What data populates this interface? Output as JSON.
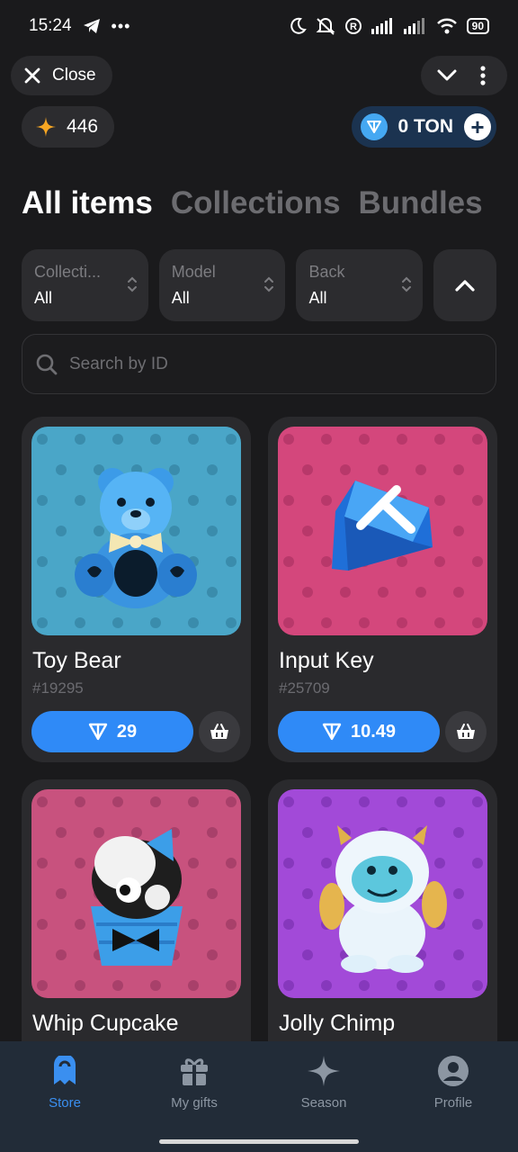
{
  "status_bar": {
    "time": "15:24",
    "battery": "90"
  },
  "topbar": {
    "close_label": "Close"
  },
  "balance": {
    "stars": "446",
    "ton": "0 TON"
  },
  "tabs": [
    {
      "label": "All items",
      "active": true
    },
    {
      "label": "Collections",
      "active": false
    },
    {
      "label": "Bundles",
      "active": false
    }
  ],
  "filters": [
    {
      "label": "Collecti...",
      "value": "All"
    },
    {
      "label": "Model",
      "value": "All"
    },
    {
      "label": "Back",
      "value": "All"
    }
  ],
  "search": {
    "placeholder": "Search by ID"
  },
  "items": [
    {
      "name": "Toy Bear",
      "id": "#19295",
      "price": "29",
      "bg": "#4aa6c8",
      "pattern": "#3a8cac"
    },
    {
      "name": "Input Key",
      "id": "#25709",
      "price": "10.49",
      "bg": "#d4477c",
      "pattern": "#b8386a"
    },
    {
      "name": "Whip Cupcake",
      "id": "",
      "price": "",
      "bg": "#c8527e",
      "pattern": "#a8406a"
    },
    {
      "name": "Jolly Chimp",
      "id": "",
      "price": "",
      "bg": "#a24ad8",
      "pattern": "#8638bc"
    }
  ],
  "nav": [
    {
      "label": "Store",
      "icon": "store-icon",
      "active": true
    },
    {
      "label": "My gifts",
      "icon": "gift-icon",
      "active": false
    },
    {
      "label": "Season",
      "icon": "sparkle-icon",
      "active": false
    },
    {
      "label": "Profile",
      "icon": "profile-icon",
      "active": false
    }
  ]
}
